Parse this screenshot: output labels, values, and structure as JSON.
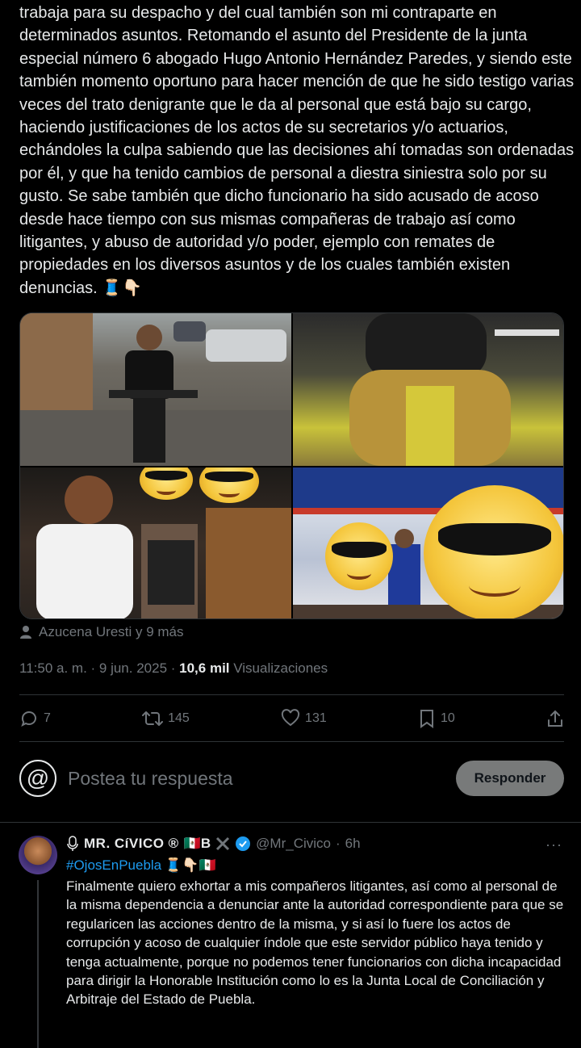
{
  "tweet": {
    "body_text": "trabaja para su despacho y del cual también son mi contraparte en determinados asuntos. Retomando el asunto del Presidente de la junta especial número 6 abogado Hugo Antonio Hernández Paredes, y siendo este también momento oportuno para hacer mención de que he sido testigo varias veces del trato denigrante que le da al personal que está bajo su cargo, haciendo justificaciones de los actos de su secretarios y/o actuarios, echándoles la culpa sabiendo que las decisiones ahí tomadas son ordenadas por él, y que ha tenido cambios de personal a diestra siniestra solo por su gusto. Se sabe también que dicho funcionario ha sido acusado de acoso desde hace tiempo con sus mismas compañeras de trabajo así como litigantes, y abuso de autoridad y/o poder, ejemplo con remates de propiedades en los diversos asuntos y de los cuales también existen denuncias. 🧵👇🏻",
    "tagged_users": "Azucena Uresti y 9 más",
    "time": "11:50 a. m. · 9 jun. 2025 · ",
    "views_count": "10,6 mil",
    "views_label": " Visualizaciones",
    "actions": {
      "replies": "7",
      "reposts": "145",
      "likes": "131",
      "bookmarks": "10"
    }
  },
  "composer": {
    "avatar_glyph": "@",
    "placeholder": "Postea tu respuesta",
    "button_label": "Responder"
  },
  "reply": {
    "display_name": "MR. CíVICO ®",
    "name_suffix": "🇲🇽B",
    "handle": "@Mr_Civico",
    "sep": "·",
    "time": "6h",
    "more_glyph": "···",
    "hashtag": "#OjosEnPuebla",
    "hashtag_emojis": "🧵👇🏻🇲🇽",
    "text": "Finalmente quiero exhortar a mis compañeros litigantes, así como al personal de la misma dependencia a denunciar ante la autoridad correspondiente para que se regularicen las acciones dentro de la misma, y si así lo fuere los actos de corrupción y acoso de cualquier índole que este servidor público haya tenido y tenga actualmente, porque no podemos tener funcionarios con dicha incapacidad para dirigir la Honorable Institución como lo es la Junta Local de Conciliación y Arbitraje del Estado de Puebla."
  },
  "colors": {
    "background": "#000000",
    "text_primary": "#e7e9ea",
    "text_secondary": "#71767b",
    "link": "#1d9bf0",
    "verified": "#1d9bf0",
    "divider": "#2f3336"
  },
  "icons": [
    "person-icon",
    "reply-icon",
    "repost-icon",
    "like-icon",
    "bookmark-icon",
    "share-icon",
    "microphone-icon",
    "x-logo-icon",
    "verified-badge-icon",
    "more-icon"
  ]
}
